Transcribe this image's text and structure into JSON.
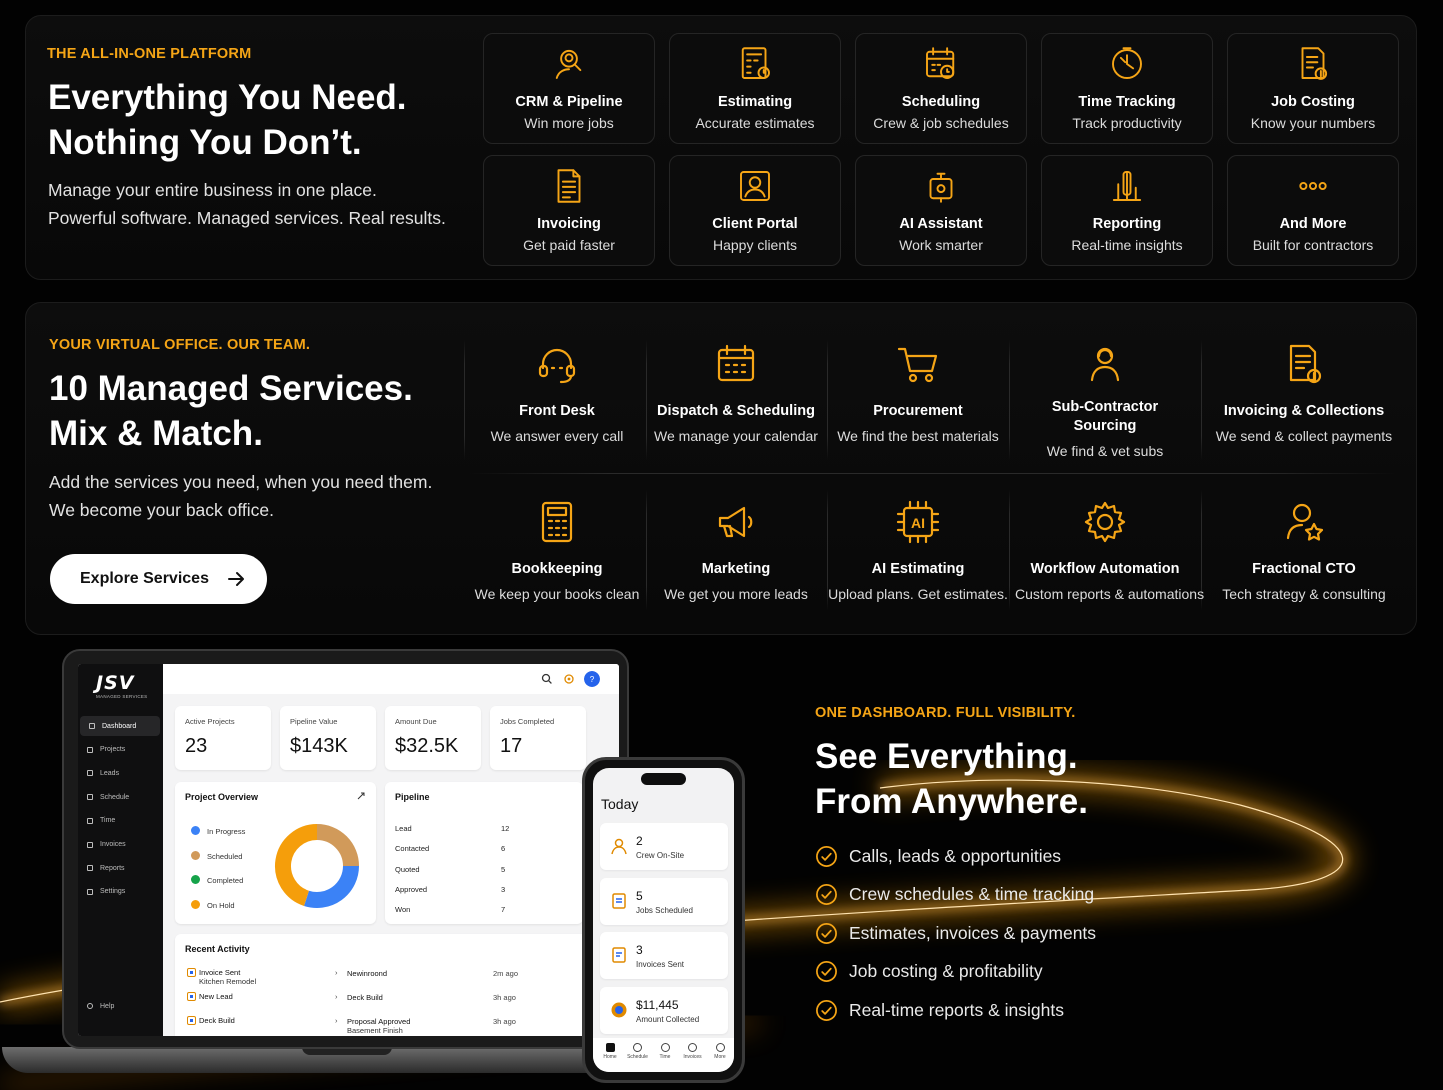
{
  "platform": {
    "eyebrow": "THE ALL-IN-ONE PLATFORM",
    "headline_line1": "Everything You Need.",
    "headline_line2": "Nothing You Don’t.",
    "sub_line1": "Manage your entire business in one place.",
    "sub_line2": "Powerful software. Managed services. Real results.",
    "features": [
      {
        "title": "CRM & Pipeline",
        "desc": "Win more jobs",
        "icon": "user-search-icon"
      },
      {
        "title": "Estimating",
        "desc": "Accurate estimates",
        "icon": "calculator-doc-icon"
      },
      {
        "title": "Scheduling",
        "desc": "Crew & job schedules",
        "icon": "calendar-clock-icon"
      },
      {
        "title": "Time Tracking",
        "desc": "Track productivity",
        "icon": "clock-icon"
      },
      {
        "title": "Job Costing",
        "desc": "Know your numbers",
        "icon": "document-dollar-icon"
      },
      {
        "title": "Invoicing",
        "desc": "Get paid faster",
        "icon": "invoice-icon"
      },
      {
        "title": "Client Portal",
        "desc": "Happy clients",
        "icon": "portal-user-icon"
      },
      {
        "title": "AI Assistant",
        "desc": "Work smarter",
        "icon": "robot-icon"
      },
      {
        "title": "Reporting",
        "desc": "Real-time insights",
        "icon": "reporting-icon"
      },
      {
        "title": "And More",
        "desc": "Built for contractors",
        "icon": "more-dots-icon"
      }
    ]
  },
  "services": {
    "eyebrow": "YOUR VIRTUAL OFFICE. OUR TEAM.",
    "headline_line1": "10 Managed Services.",
    "headline_line2": "Mix & Match.",
    "sub_line1": "Add the services you need, when you need them.",
    "sub_line2": "We become your back office.",
    "cta_label": "Explore Services",
    "items": [
      {
        "title": "Front Desk",
        "desc": "We answer every call",
        "icon": "headset-icon"
      },
      {
        "title": "Dispatch & Scheduling",
        "desc": "We manage your calendar",
        "icon": "calendar-icon"
      },
      {
        "title": "Procurement",
        "desc": "We find the best materials",
        "icon": "cart-icon"
      },
      {
        "title": "Sub-Contractor Sourcing",
        "desc": "We find & vet subs",
        "icon": "team-icon"
      },
      {
        "title": "Invoicing & Collections",
        "desc": "We send & collect payments",
        "icon": "invoice-dollar-icon"
      },
      {
        "title": "Bookkeeping",
        "desc": "We keep your books clean",
        "icon": "calculator-icon"
      },
      {
        "title": "Marketing",
        "desc": "We get you more leads",
        "icon": "megaphone-icon"
      },
      {
        "title": "AI Estimating",
        "desc": "Upload plans. Get estimates.",
        "icon": "ai-chip-icon"
      },
      {
        "title": "Workflow Automation",
        "desc": "Custom reports & automations",
        "icon": "gear-icon"
      },
      {
        "title": "Fractional CTO",
        "desc": "Tech strategy & consulting",
        "icon": "user-star-icon"
      }
    ]
  },
  "dashboard_section": {
    "eyebrow": "ONE DASHBOARD. FULL VISIBILITY.",
    "headline_line1": "See Everything.",
    "headline_line2": "From Anywhere.",
    "bullets": [
      "Calls, leads & opportunities",
      "Crew schedules & time tracking",
      "Estimates, invoices & payments",
      "Job costing & profitability",
      "Real-time reports & insights"
    ]
  },
  "app": {
    "logo": "JSV",
    "logo_sub": "MANAGED SERVICES",
    "nav": [
      "Dashboard",
      "Projects",
      "Leads",
      "Schedule",
      "Time",
      "Invoices",
      "Reports",
      "Settings"
    ],
    "nav_help": "Help",
    "stats": [
      {
        "label": "Active Projects",
        "value": "23"
      },
      {
        "label": "Pipeline Value",
        "value": "$143K"
      },
      {
        "label": "Amount Due",
        "value": "$32.5K"
      },
      {
        "label": "Jobs Completed",
        "value": "17"
      }
    ],
    "overview": {
      "title": "Project Overview",
      "legend": [
        {
          "label": "In Progress",
          "color": "#3b82f6",
          "value": 30
        },
        {
          "label": "Scheduled",
          "color": "#d19a5a",
          "value": 25
        },
        {
          "label": "Completed",
          "color": "#16a34a",
          "value": 0
        },
        {
          "label": "On Hold",
          "color": "#f59e0b",
          "value": 45
        }
      ]
    },
    "pipeline": {
      "title": "Pipeline",
      "rows": [
        {
          "stage": "Lead",
          "count": "12"
        },
        {
          "stage": "Contacted",
          "count": "6"
        },
        {
          "stage": "Quoted",
          "count": "5"
        },
        {
          "stage": "Approved",
          "count": "3"
        },
        {
          "stage": "Won",
          "count": "7"
        }
      ]
    },
    "activity": {
      "title": "Recent Activity",
      "rows": [
        {
          "title": "Invoice Sent",
          "sub": "Kitchen Remodel",
          "target": "Newinroond",
          "target_sub": "",
          "time": "2m ago"
        },
        {
          "title": "New Lead",
          "sub": "",
          "target": "Deck Build",
          "target_sub": "",
          "time": "3h ago"
        },
        {
          "title": "Deck Build",
          "sub": "",
          "target": "Proposal Approved",
          "target_sub": "Basement Finish",
          "time": "3h ago"
        }
      ]
    }
  },
  "phone": {
    "title": "Today",
    "cards": [
      {
        "num": "2",
        "label": "Crew On-Site",
        "icon": "crew-icon"
      },
      {
        "num": "5",
        "label": "Jobs Scheduled",
        "icon": "schedule-doc-icon"
      },
      {
        "num": "3",
        "label": "Invoices Sent",
        "icon": "invoice-doc-icon"
      },
      {
        "num": "$11,445",
        "label": "Amount Collected",
        "icon": "money-icon"
      }
    ],
    "tabs": [
      "Home",
      "Schedule",
      "Time",
      "Invoices",
      "More"
    ]
  },
  "colors": {
    "accent": "#f5a516",
    "background": "#020202"
  }
}
